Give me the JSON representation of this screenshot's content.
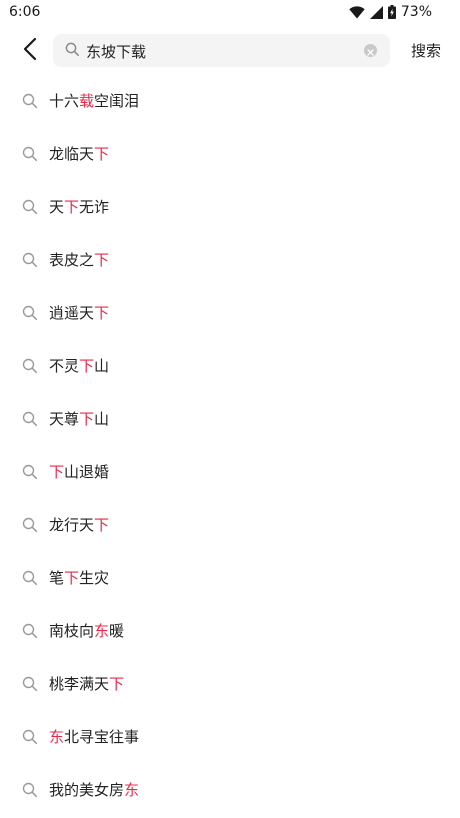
{
  "status_bar": {
    "time": "6:06",
    "battery": "73%"
  },
  "header": {
    "search_value": "东坡下载",
    "search_button_label": "搜索"
  },
  "colors": {
    "highlight": "#e8294c",
    "text": "#222222",
    "icon": "#9a9a9a"
  },
  "suggestions": [
    {
      "pre": "十六",
      "hl": "载",
      "post": "空闺泪"
    },
    {
      "pre": "龙临天",
      "hl": "下",
      "post": ""
    },
    {
      "pre": "天",
      "hl": "下",
      "post": "无诈"
    },
    {
      "pre": "表皮之",
      "hl": "下",
      "post": ""
    },
    {
      "pre": "逍遥天",
      "hl": "下",
      "post": ""
    },
    {
      "pre": "不灵",
      "hl": "下",
      "post": "山"
    },
    {
      "pre": "天尊",
      "hl": "下",
      "post": "山"
    },
    {
      "pre": "",
      "hl": "下",
      "post": "山退婚"
    },
    {
      "pre": "龙行天",
      "hl": "下",
      "post": ""
    },
    {
      "pre": "笔",
      "hl": "下",
      "post": "生灾"
    },
    {
      "pre": "南枝向",
      "hl": "东",
      "post": "暖"
    },
    {
      "pre": "桃李满天",
      "hl": "下",
      "post": ""
    },
    {
      "pre": "",
      "hl": "东",
      "post": "北寻宝往事"
    },
    {
      "pre": "我的美女房",
      "hl": "东",
      "post": ""
    }
  ]
}
